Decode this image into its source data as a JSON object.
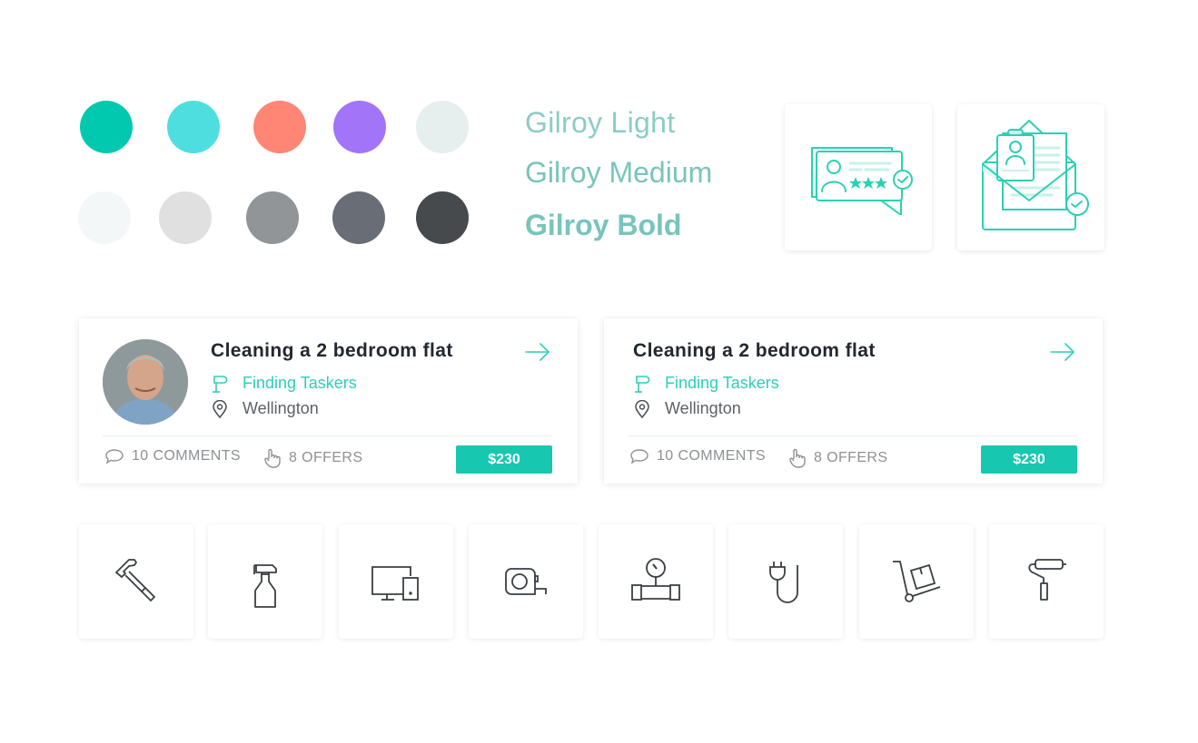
{
  "palette": {
    "row1": [
      "#00c9b0",
      "#4fdee0",
      "#ff8674",
      "#a274f7",
      "#e7eeee"
    ],
    "row2": [
      "#f4f7f8",
      "#e0e0e0",
      "#929598",
      "#696d75",
      "#474a4d"
    ]
  },
  "typography": {
    "color": "#79c4bc",
    "samples": [
      "Gilroy Light",
      "Gilroy Medium",
      "Gilroy Bold"
    ]
  },
  "illustrations": [
    {
      "icon": "review-card-icon",
      "accent": "#2ad1b4"
    },
    {
      "icon": "envelope-resume-icon",
      "accent": "#2ad1b4"
    }
  ],
  "task_cards": [
    {
      "has_avatar": true,
      "title": "Cleaning a 2 bedroom flat",
      "status": "Finding Taskers",
      "location": "Wellington",
      "comments": "10 COMMENTS",
      "offers": "8 OFFERS",
      "price": "$230"
    },
    {
      "has_avatar": false,
      "title": "Cleaning a 2 bedroom flat",
      "status": "Finding Taskers",
      "location": "Wellington",
      "comments": "10 COMMENTS",
      "offers": "8 OFFERS",
      "price": "$230"
    }
  ],
  "categories": [
    {
      "icon": "hammer-icon"
    },
    {
      "icon": "spray-bottle-icon"
    },
    {
      "icon": "computer-devices-icon"
    },
    {
      "icon": "tape-measure-icon"
    },
    {
      "icon": "pressure-gauge-pipe-icon"
    },
    {
      "icon": "power-plug-icon"
    },
    {
      "icon": "hand-truck-icon"
    },
    {
      "icon": "paint-roller-icon"
    }
  ],
  "colors": {
    "accent": "#18c7b0",
    "accent_text": "#2ecfb6",
    "text_dark": "#23282f",
    "text_muted": "#8d9094",
    "icon_stroke": "#3a3f44"
  }
}
